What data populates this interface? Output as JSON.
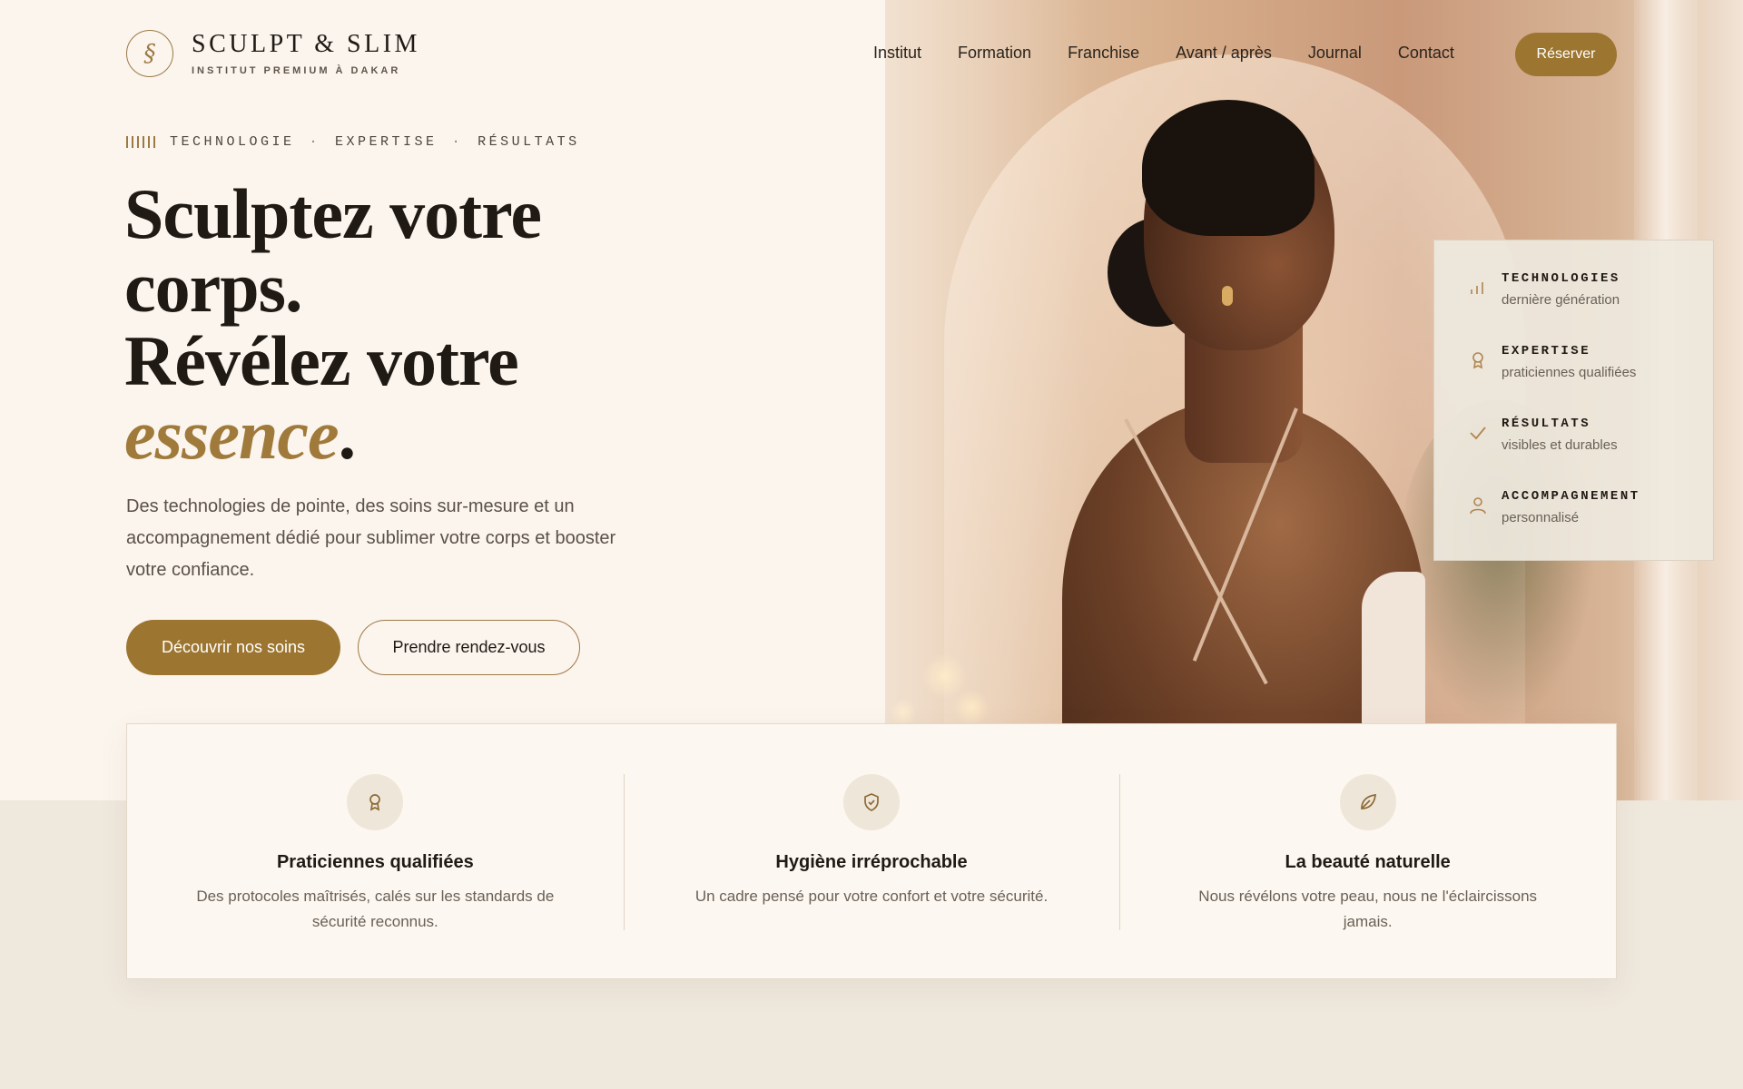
{
  "brand": {
    "name": "SCULPT & SLIM",
    "tagline": "INSTITUT PREMIUM À DAKAR"
  },
  "nav": {
    "items": [
      "Institut",
      "Formation",
      "Franchise",
      "Avant / après",
      "Journal",
      "Contact"
    ],
    "cta": "Réserver"
  },
  "hero": {
    "eyebrow": [
      "TECHNOLOGIE",
      "EXPERTISE",
      "RÉSULTATS"
    ],
    "eyebrow_separator": "·",
    "headline_line1": "Sculptez votre",
    "headline_line2": "corps.",
    "headline_line3": "Révélez votre",
    "headline_accent": "essence",
    "headline_end": ".",
    "lead": "Des technologies de pointe, des soins sur-mesure et un accompagnement dédié pour sublimer votre corps et booster votre confiance.",
    "primary_cta": "Découvrir nos soins",
    "secondary_cta": "Prendre rendez-vous"
  },
  "sidecard": {
    "items": [
      {
        "title": "TECHNOLOGIES",
        "subtitle": "dernière génération",
        "icon": "bar-chart-icon"
      },
      {
        "title": "EXPERTISE",
        "subtitle": "praticiennes qualifiées",
        "icon": "award-icon"
      },
      {
        "title": "RÉSULTATS",
        "subtitle": "visibles et durables",
        "icon": "check-icon"
      },
      {
        "title": "ACCOMPAGNEMENT",
        "subtitle": "personnalisé",
        "icon": "user-icon"
      }
    ]
  },
  "features": [
    {
      "title": "Praticiennes qualifiées",
      "text": "Des protocoles maîtrisés, calés sur les standards de sécurité reconnus.",
      "icon": "award-icon"
    },
    {
      "title": "Hygiène irréprochable",
      "text": "Un cadre pensé pour votre confort et votre sécurité.",
      "icon": "shield-check-icon"
    },
    {
      "title": "La beauté naturelle",
      "text": "Nous révélons votre peau, nous ne l'éclaircissons jamais.",
      "icon": "leaf-icon"
    }
  ],
  "colors": {
    "accent": "#9c7530",
    "accent_text": "#a07a3a",
    "background": "#fbf5ee",
    "lower_background": "#efe8dd",
    "text": "#1f1a14"
  }
}
